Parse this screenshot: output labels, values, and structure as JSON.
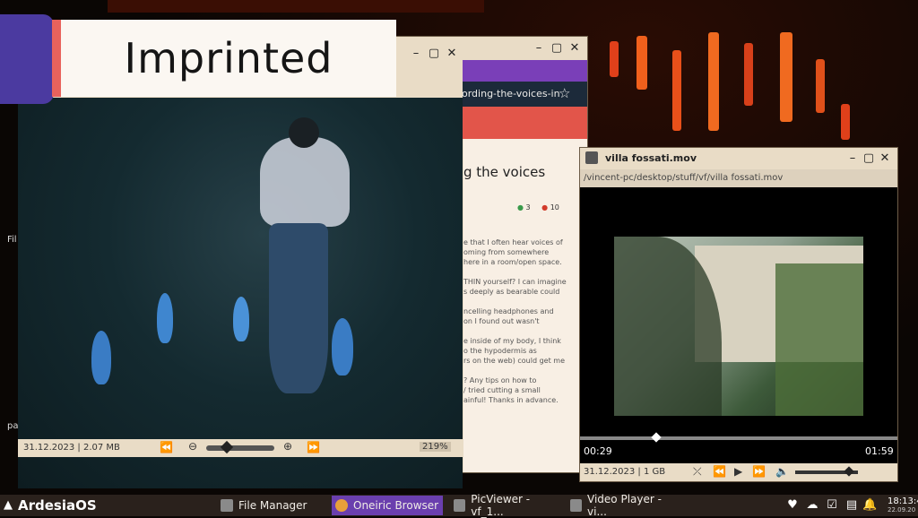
{
  "title_card": {
    "text": "Imprinted"
  },
  "browser": {
    "address": "ording-the-voices-in",
    "heading": "g the voices",
    "up_count": "3",
    "down_count": "10",
    "body_lines": [
      "e that I often hear voices of",
      "oming from somewhere",
      "here in a room/open space.",
      "",
      "THIN yourself? I can imagine",
      "s deeply as bearable could",
      "",
      "ncelling headphones and",
      "on I found out wasn't",
      "",
      "e inside of my body, I think",
      "o the hypodermis as",
      "rs on the web) could get me",
      "",
      "? Any tips on how to",
      "/ tried cutting a small",
      "ainful! Thanks in advance."
    ]
  },
  "picviewer": {
    "status": "31.12.2023 | 2.07 MB",
    "zoom": "219%",
    "slider_fraction": 0.3
  },
  "video": {
    "title": "villa fossati.mov",
    "path": "/vincent-pc/desktop/stuff/vf/villa fossati.mov",
    "time_current": "00:29",
    "time_total": "01:59",
    "progress_fraction": 0.24,
    "status": "31.12.2023 | 1 GB",
    "volume_fraction": 0.85
  },
  "desktop": {
    "left_label_1": "Fil",
    "left_label_2": "pa"
  },
  "taskbar": {
    "os_name": "ArdesiaOS",
    "items": [
      {
        "label": "File Manager"
      },
      {
        "label": "Oneiric Browser"
      },
      {
        "label": "PicViewer - vf_1..."
      },
      {
        "label": "Video Player - vi..."
      }
    ],
    "clock": "18:13:4",
    "date": "22.09.20"
  }
}
